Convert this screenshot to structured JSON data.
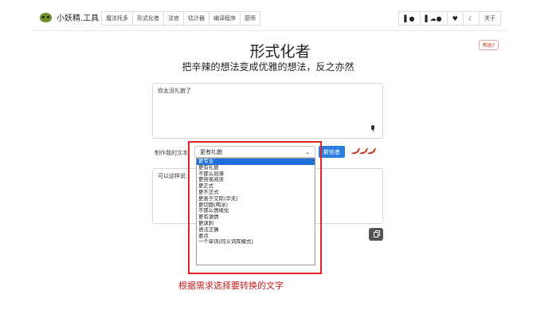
{
  "app": {
    "brand": "小妖精.工具",
    "nav_left": [
      "魔法托多",
      "形式化者",
      "法官",
      "估计器",
      "编译程序",
      "厨师"
    ],
    "nav_right_icons": [
      "flag-icon",
      "platform-icons",
      "heart-icon",
      "moon-icon"
    ],
    "about_label": "关于",
    "help_label": "帮助?"
  },
  "page": {
    "title": "形式化者",
    "subtitle": "把辛辣的想法变成优雅的想法，反之亦然"
  },
  "input": {
    "value": "你太没礼貌了"
  },
  "controls": {
    "label": "制作我的文本",
    "selected_option": "更有礼貌",
    "convert_label": "斯依者",
    "spiciness_icons": [
      "pepper-icon",
      "pepper-icon",
      "pepper-icon"
    ]
  },
  "dropdown": {
    "options": [
      "更专业",
      "更有礼貌",
      "不那么刻薄",
      "更容易阅读",
      "更正式",
      "更不正式",
      "更善于交际(华夫)",
      "更切题(喝冰)",
      "不那么情绪化",
      "更有激情",
      "更讽刺",
      "语法正确",
      "要点",
      "一个单词(同义词库模式)"
    ],
    "highlighted_index": 0
  },
  "output": {
    "value": "可以这样说："
  },
  "annotation": {
    "text": "根据需求选择要转换的文字",
    "color": "#c0201f"
  },
  "colors": {
    "primary_button": "#2b7de0",
    "selection": "#1e6fd9",
    "highlight_box": "#e02424"
  }
}
